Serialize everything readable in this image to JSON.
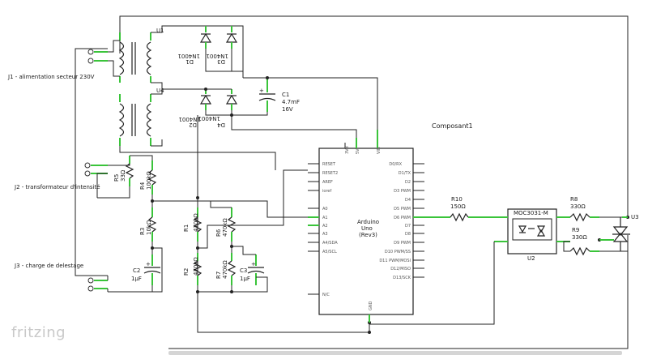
{
  "connectors": {
    "j1": "J1 - alimentation secteur 230V",
    "j2": "J2 - transformateur d'intensité",
    "j3": "J3 - charge de delestage"
  },
  "transformers": {
    "u1": "U1",
    "u4": "U4"
  },
  "diodes": [
    {
      "ref": "D1",
      "value": "1N4001"
    },
    {
      "ref": "D2",
      "value": "1N4001"
    },
    {
      "ref": "D3",
      "value": "1N4001"
    },
    {
      "ref": "D4",
      "value": "1N4001"
    }
  ],
  "capacitors": [
    {
      "ref": "C1",
      "value": "4.7mF",
      "voltage": "16V"
    },
    {
      "ref": "C2",
      "value": "1µF"
    },
    {
      "ref": "C3",
      "value": "1µF"
    }
  ],
  "resistors": [
    {
      "ref": "R1",
      "value": "470kΩ"
    },
    {
      "ref": "R2",
      "value": "470kΩ"
    },
    {
      "ref": "R3",
      "value": "10kΩ"
    },
    {
      "ref": "R4",
      "value": "100kΩ"
    },
    {
      "ref": "R5",
      "value": "33Ω"
    },
    {
      "ref": "R6",
      "value": "470kΩ"
    },
    {
      "ref": "R7",
      "value": "470kΩ"
    },
    {
      "ref": "R8",
      "value": "330Ω"
    },
    {
      "ref": "R9",
      "value": "330Ω"
    },
    {
      "ref": "R10",
      "value": "150Ω"
    }
  ],
  "arduino": {
    "name": "Arduino",
    "model": "Uno",
    "rev": "(Rev3)",
    "component_label": "Composant1",
    "left_pins": [
      "RESET",
      "RESET2",
      "AREF",
      "ioref",
      "A0",
      "A1",
      "A2",
      "A3",
      "A4/SDA",
      "A5/SCL",
      "N/C"
    ],
    "right_pins": [
      "D0/RX",
      "D1/TX",
      "D2",
      "D3 PWM",
      "D4",
      "D5 PWM",
      "D6 PWM",
      "D7",
      "D8",
      "D9 PWM",
      "D10 PWM/SS",
      "D11 PWM/MOSI",
      "D12/MISO",
      "D13/SCK"
    ],
    "top_pins": [
      "3V3",
      "5V",
      "VIN"
    ],
    "bottom_pin": "GND"
  },
  "optocoupler": {
    "ref": "U2",
    "part": "MOC3031-M"
  },
  "triac": {
    "ref": "U3"
  },
  "watermark": "fritzing"
}
